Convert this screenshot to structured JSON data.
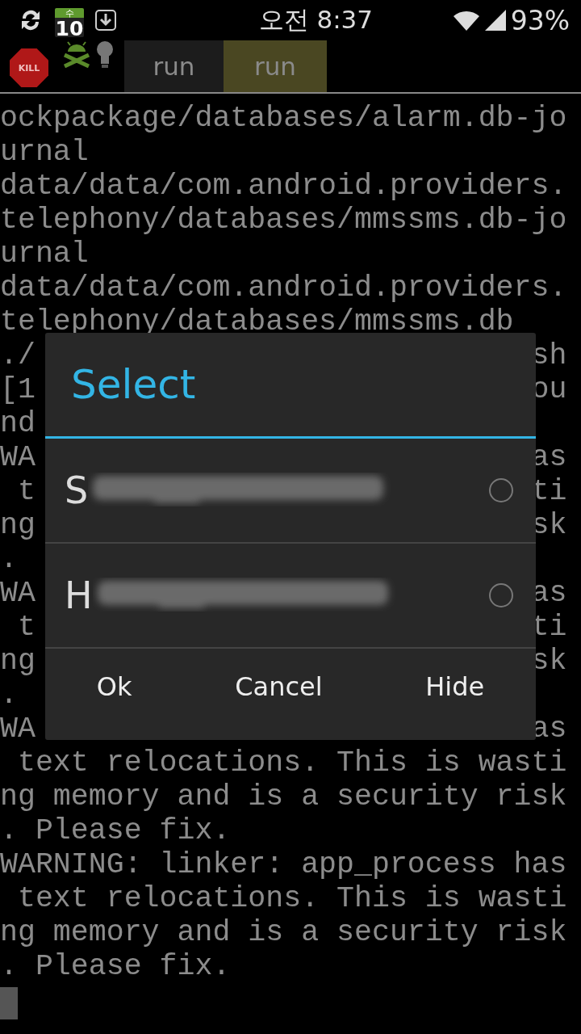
{
  "status_bar": {
    "calendar": {
      "weekday": "수",
      "day": "10"
    },
    "time": "오전 8:37",
    "battery": "93%"
  },
  "toolbar": {
    "kill_button": "KILL",
    "tabs": [
      {
        "label": "run",
        "selected": false
      },
      {
        "label": "run",
        "selected": true
      }
    ]
  },
  "terminal": {
    "lines": [
      {
        "left": "ockpackage/databases/alarm.db-jo"
      },
      {
        "left": "urnal"
      },
      {
        "left": "data/data/com.android.providers."
      },
      {
        "left": "telephony/databases/mmssms.db-jo"
      },
      {
        "left": "urnal"
      },
      {
        "left": "data/data/com.android.providers."
      },
      {
        "left": "telephony/databases/mmssms.db"
      },
      {
        "left": "./",
        "right": "sh"
      },
      {
        "left": "[1",
        "right": "ou"
      },
      {
        "left": "nd"
      },
      {
        "left": "WA",
        "right": "as"
      },
      {
        "left": " t",
        "right": "ti"
      },
      {
        "left": "ng",
        "right": "sk"
      },
      {
        "left": "."
      },
      {
        "left": "WA",
        "right": "as"
      },
      {
        "left": " t",
        "right": "ti"
      },
      {
        "left": "ng",
        "right": "sk"
      },
      {
        "left": "."
      },
      {
        "left": "WA",
        "right": "as"
      },
      {
        "left": " text relocations. This is wasti"
      },
      {
        "left": "ng memory and is a security risk"
      },
      {
        "left": ". Please fix."
      },
      {
        "left": "WARNING: linker: app_process has"
      },
      {
        "left": " text relocations. This is wasti"
      },
      {
        "left": "ng memory and is a security risk"
      },
      {
        "left": ". Please fix."
      }
    ]
  },
  "dialog": {
    "title": "Select",
    "options": [
      {
        "label": "S",
        "selected": false
      },
      {
        "label": "H",
        "selected": false
      }
    ],
    "buttons": [
      "Ok",
      "Cancel",
      "Hide"
    ]
  }
}
